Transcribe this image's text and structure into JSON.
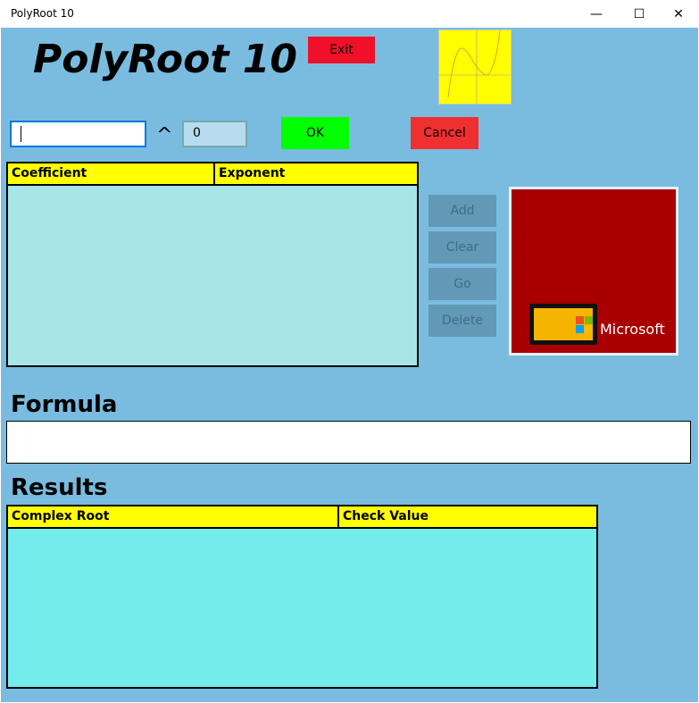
{
  "window": {
    "title": "PolyRoot 10",
    "minimize": "—",
    "maximize": "☐",
    "close": "✕"
  },
  "app": {
    "title": "PolyRoot 10",
    "exit": "Exit",
    "ok": "OK",
    "cancel": "Cancel",
    "caret_symbol": "^"
  },
  "inputs": {
    "coefficient_value": "",
    "exponent_value": "0"
  },
  "terms_grid": {
    "columns": [
      "Coefficient",
      "Exponent"
    ]
  },
  "side_buttons": {
    "add": "Add",
    "clear": "Clear",
    "go": "Go",
    "delete": "Delete"
  },
  "ad": {
    "brand": "Microsoft"
  },
  "formula": {
    "heading": "Formula",
    "value": ""
  },
  "results": {
    "heading": "Results",
    "columns": [
      "Complex Root",
      "Check Value"
    ]
  },
  "colors": {
    "background": "#79bce0",
    "exit": "#f0102a",
    "ok": "#00ff00",
    "cancel": "#f03030",
    "header": "#ffff00"
  }
}
